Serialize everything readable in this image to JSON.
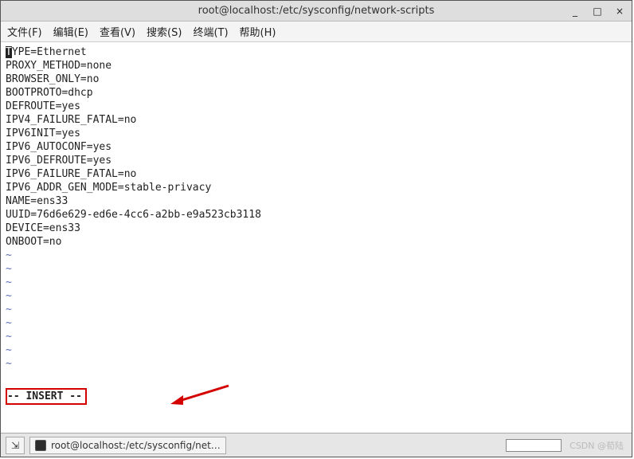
{
  "window": {
    "title": "root@localhost:/etc/sysconfig/network-scripts"
  },
  "winbtns": {
    "min": "_",
    "max": "□",
    "close": "×"
  },
  "menu": {
    "file": "文件(F)",
    "edit": "编辑(E)",
    "view": "查看(V)",
    "search": "搜索(S)",
    "term": "终端(T)",
    "help": "帮助(H)"
  },
  "file_content": {
    "cursor_char": "T",
    "first_line_rest": "YPE=Ethernet",
    "lines": [
      "PROXY_METHOD=none",
      "BROWSER_ONLY=no",
      "BOOTPROTO=dhcp",
      "DEFROUTE=yes",
      "IPV4_FAILURE_FATAL=no",
      "IPV6INIT=yes",
      "IPV6_AUTOCONF=yes",
      "IPV6_DEFROUTE=yes",
      "IPV6_FAILURE_FATAL=no",
      "IPV6_ADDR_GEN_MODE=stable-privacy",
      "NAME=ens33",
      "UUID=76d6e629-ed6e-4cc6-a2bb-e9a523cb3118",
      "DEVICE=ens33",
      "ONBOOT=no"
    ]
  },
  "tilde": "~",
  "status": {
    "mode": "-- INSERT --"
  },
  "taskbar": {
    "sysicon": "⇲",
    "app_label": "root@localhost:/etc/sysconfig/net…"
  },
  "watermark": "CSDN @荀陆"
}
